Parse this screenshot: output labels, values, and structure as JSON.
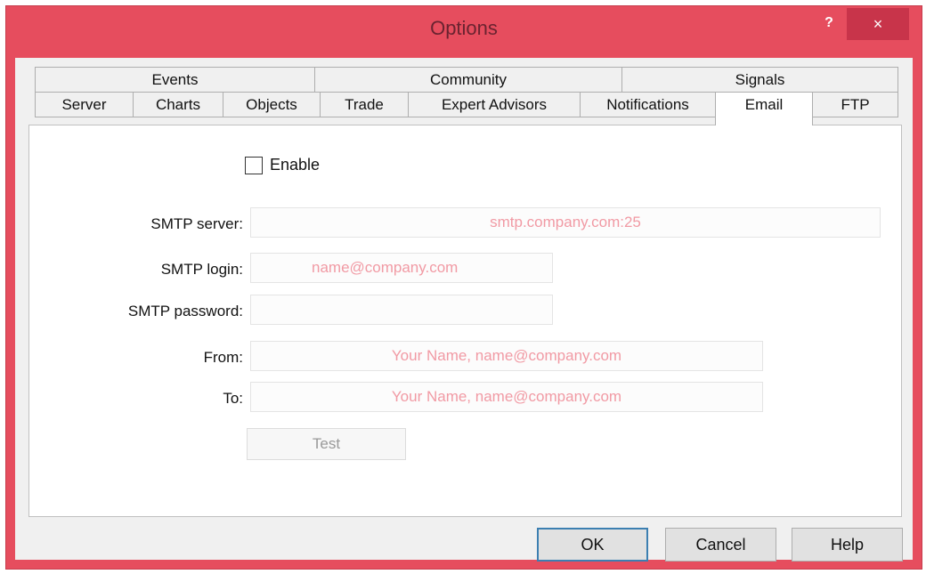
{
  "window": {
    "title": "Options",
    "help_glyph": "?",
    "close_glyph": "×"
  },
  "tabs_row1": [
    {
      "label": "Events"
    },
    {
      "label": "Community"
    },
    {
      "label": "Signals"
    }
  ],
  "tabs_row2": [
    {
      "label": "Server"
    },
    {
      "label": "Charts"
    },
    {
      "label": "Objects"
    },
    {
      "label": "Trade"
    },
    {
      "label": "Expert Advisors"
    },
    {
      "label": "Notifications"
    },
    {
      "label": "Email",
      "active": true
    },
    {
      "label": "FTP"
    }
  ],
  "email": {
    "enable_label": "Enable",
    "enable_checked": false,
    "smtp_server_label": "SMTP server:",
    "smtp_server_placeholder": "smtp.company.com:25",
    "smtp_login_label": "SMTP login:",
    "smtp_login_placeholder": "name@company.com",
    "smtp_password_label": "SMTP password:",
    "smtp_password_value": "",
    "from_label": "From:",
    "from_placeholder": "Your Name, name@company.com",
    "to_label": "To:",
    "to_placeholder": "Your Name, name@company.com",
    "test_label": "Test"
  },
  "footer": {
    "ok_label": "OK",
    "cancel_label": "Cancel",
    "help_label": "Help"
  },
  "colors": {
    "titlebar": "#e64d5e",
    "close_button": "#c8344a",
    "placeholder_text": "#f19aa4",
    "default_button_border": "#3c7fb1"
  }
}
